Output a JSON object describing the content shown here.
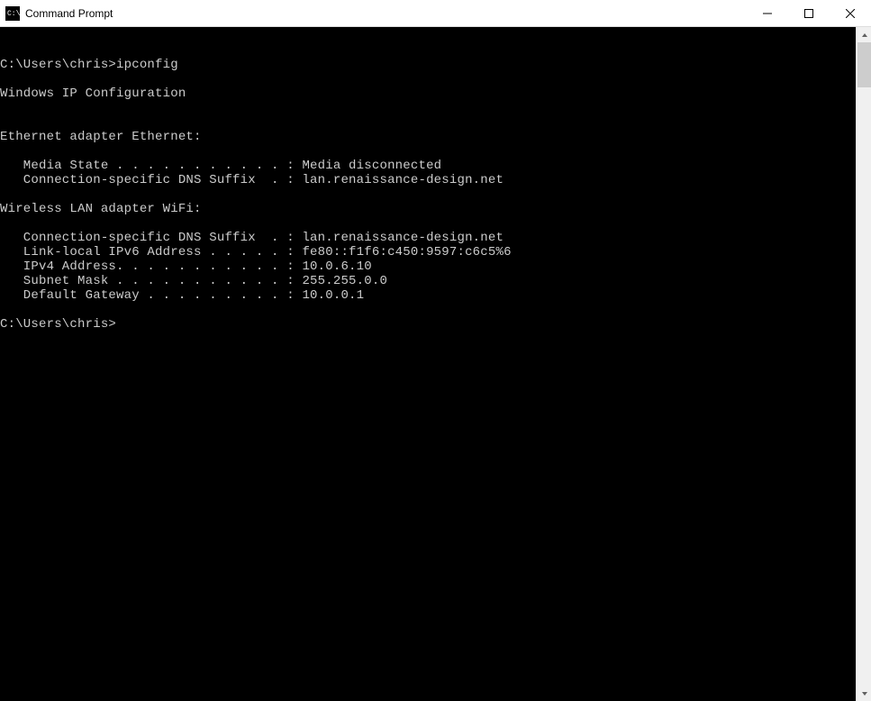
{
  "window": {
    "title": "Command Prompt"
  },
  "terminal": {
    "lines": [
      "C:\\Users\\chris>ipconfig",
      "",
      "Windows IP Configuration",
      "",
      "",
      "Ethernet adapter Ethernet:",
      "",
      "   Media State . . . . . . . . . . . : Media disconnected",
      "   Connection-specific DNS Suffix  . : lan.renaissance-design.net",
      "",
      "Wireless LAN adapter WiFi:",
      "",
      "   Connection-specific DNS Suffix  . : lan.renaissance-design.net",
      "   Link-local IPv6 Address . . . . . : fe80::f1f6:c450:9597:c6c5%6",
      "   IPv4 Address. . . . . . . . . . . : 10.0.6.10",
      "   Subnet Mask . . . . . . . . . . . : 255.255.0.0",
      "   Default Gateway . . . . . . . . . : 10.0.0.1",
      "",
      "C:\\Users\\chris>"
    ]
  }
}
